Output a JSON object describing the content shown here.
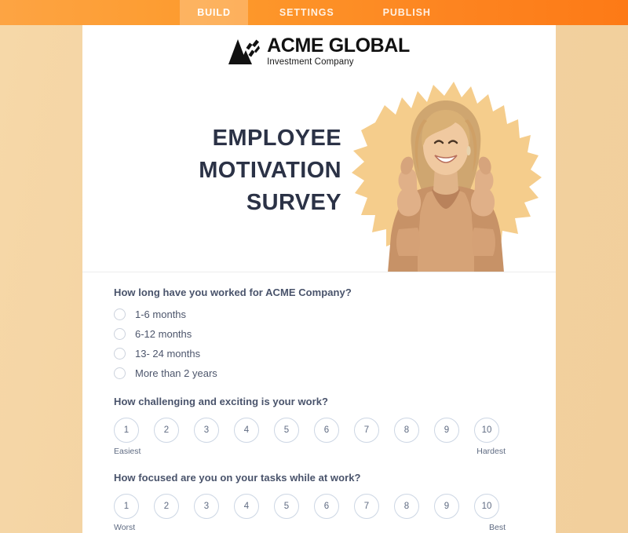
{
  "topbar": {
    "tabs": [
      {
        "label": "BUILD",
        "active": true
      },
      {
        "label": "SETTINGS",
        "active": false
      },
      {
        "label": "PUBLISH",
        "active": false
      }
    ],
    "background_color": "#fd9a2c"
  },
  "page": {
    "background_color": "#f2d2a0",
    "canvas_color": "#ffffff"
  },
  "logo": {
    "mark": "mountain-arrow-logo-icon",
    "title": "ACME GLOBAL",
    "subtitle": "Investment Company"
  },
  "hero": {
    "title_line1": "EMPLOYEE",
    "title_line2": "MOTIVATION",
    "title_line3": "SURVEY",
    "title_color": "#2b3246",
    "art": "woman-thumbs-up-photo",
    "blob_color": "#f5cd8c"
  },
  "questions": [
    {
      "type": "radio",
      "text": "How long have you worked for ACME Company?",
      "options": [
        "1-6 months",
        "6-12 months",
        "13- 24 months",
        "More than 2 years"
      ]
    },
    {
      "type": "scale",
      "text": "How challenging and exciting is your work?",
      "values": [
        "1",
        "2",
        "3",
        "4",
        "5",
        "6",
        "7",
        "8",
        "9",
        "10"
      ],
      "anchor_low": "Easiest",
      "anchor_high": "Hardest"
    },
    {
      "type": "scale",
      "text": "How focused are you on your tasks while at work?",
      "values": [
        "1",
        "2",
        "3",
        "4",
        "5",
        "6",
        "7",
        "8",
        "9",
        "10"
      ],
      "anchor_low": "Worst",
      "anchor_high": "Best"
    }
  ]
}
